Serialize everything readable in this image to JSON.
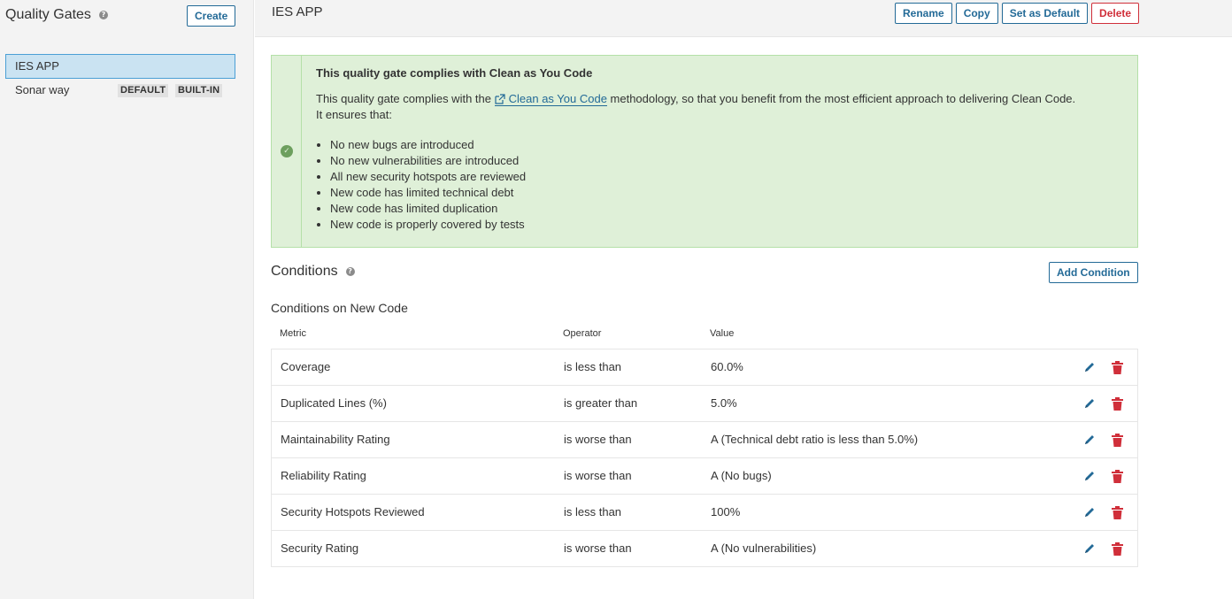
{
  "sidebar": {
    "title": "Quality Gates",
    "help_icon": "help-icon",
    "create_label": "Create",
    "gates": [
      {
        "name": "IES APP",
        "selected": true
      },
      {
        "name": "Sonar way",
        "badges": [
          "DEFAULT",
          "BUILT-IN"
        ]
      }
    ]
  },
  "header": {
    "gate_name": "IES APP",
    "rename_label": "Rename",
    "copy_label": "Copy",
    "set_default_label": "Set as Default",
    "delete_label": "Delete"
  },
  "info": {
    "icon": "check-circle-icon",
    "title": "This quality gate complies with Clean as You Code",
    "text_before": "This quality gate complies with the ",
    "link_text": "Clean as You Code",
    "text_after": " methodology, so that you benefit from the most efficient approach to delivering Clean Code.",
    "text_line2": "It ensures that:",
    "items": [
      "No new bugs are introduced",
      "No new vulnerabilities are introduced",
      "All new security hotspots are reviewed",
      "New code has limited technical debt",
      "New code has limited duplication",
      "New code is properly covered by tests"
    ]
  },
  "conditions": {
    "title": "Conditions",
    "add_label": "Add Condition",
    "subtitle": "Conditions on New Code",
    "headers": {
      "metric": "Metric",
      "operator": "Operator",
      "value": "Value"
    },
    "rows": [
      {
        "metric": "Coverage",
        "operator": "is less than",
        "value": "60.0%"
      },
      {
        "metric": "Duplicated Lines (%)",
        "operator": "is greater than",
        "value": "5.0%"
      },
      {
        "metric": "Maintainability Rating",
        "operator": "is worse than",
        "value": "A  (Technical debt ratio is less than 5.0%)"
      },
      {
        "metric": "Reliability Rating",
        "operator": "is worse than",
        "value": "A  (No bugs)"
      },
      {
        "metric": "Security Hotspots Reviewed",
        "operator": "is less than",
        "value": "100%"
      },
      {
        "metric": "Security Rating",
        "operator": "is worse than",
        "value": "A  (No vulnerabilities)"
      }
    ]
  },
  "colors": {
    "accent": "#236a97",
    "danger": "#d02f3a",
    "success_bg": "#dff0d8",
    "selected_bg": "#cae3f2"
  }
}
